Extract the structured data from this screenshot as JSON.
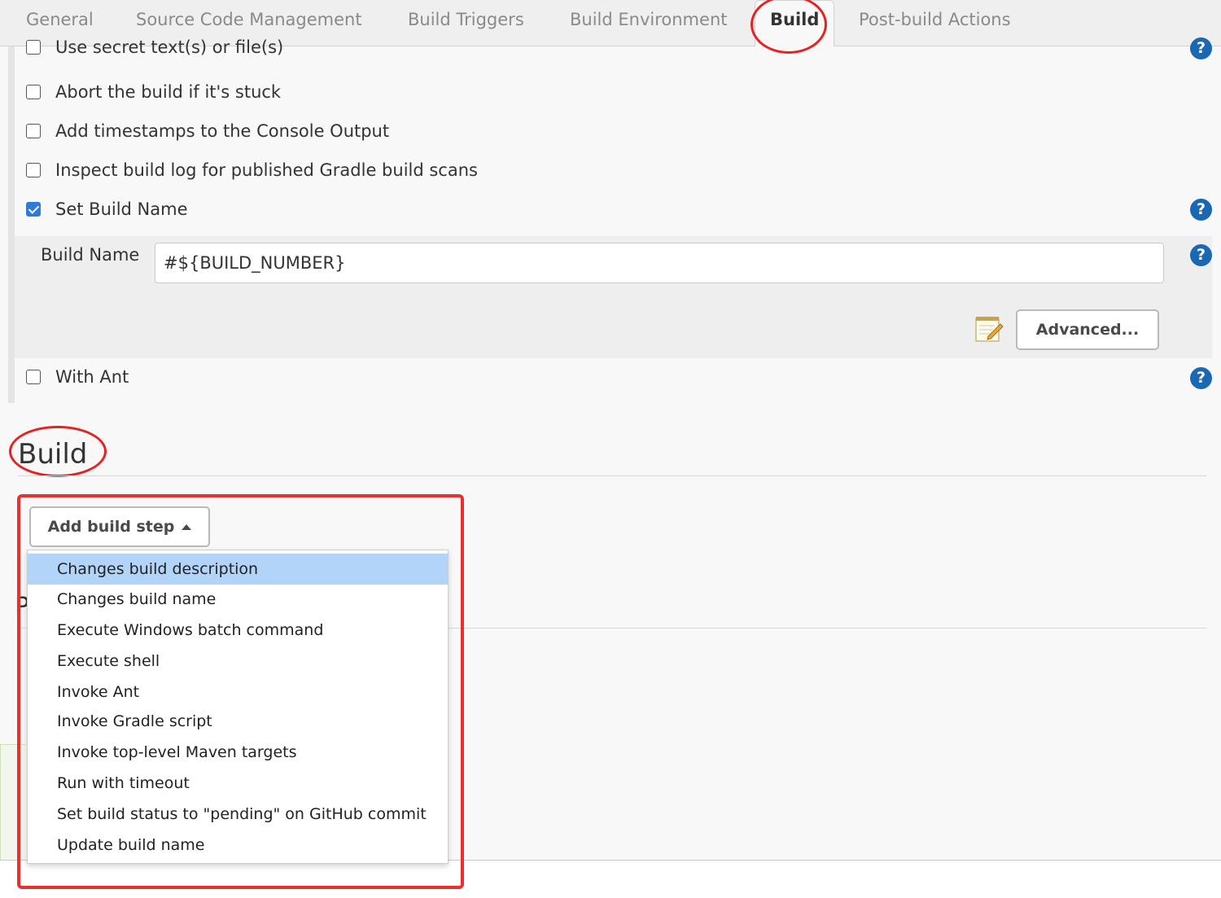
{
  "tabs": [
    {
      "label": "General"
    },
    {
      "label": "Source Code Management"
    },
    {
      "label": "Build Triggers"
    },
    {
      "label": "Build Environment"
    },
    {
      "label": "Build"
    },
    {
      "label": "Post-build Actions"
    }
  ],
  "active_tab": "Build",
  "environment_options": [
    {
      "label": "Use secret text(s) or file(s)",
      "checked": false
    },
    {
      "label": "Abort the build if it's stuck",
      "checked": false
    },
    {
      "label": "Add timestamps to the Console Output",
      "checked": false
    },
    {
      "label": "Inspect build log for published Gradle build scans",
      "checked": false
    },
    {
      "label": "Set Build Name",
      "checked": true
    },
    {
      "label": "With Ant",
      "checked": false
    }
  ],
  "build_name_field": {
    "label": "Build Name",
    "value": "#${BUILD_NUMBER}"
  },
  "advanced_button": {
    "label": "Advanced..."
  },
  "help_glyph": "?",
  "build_section": {
    "title": "Build"
  },
  "add_build_step_button": {
    "label": "Add build step"
  },
  "build_step_menu": [
    {
      "label": "Changes build description",
      "highlighted": true
    },
    {
      "label": "Changes build name"
    },
    {
      "label": "Execute Windows batch command"
    },
    {
      "label": "Execute shell"
    },
    {
      "label": "Invoke Ant"
    },
    {
      "label": "Invoke Gradle script"
    },
    {
      "label": "Invoke top-level Maven targets"
    },
    {
      "label": "Run with timeout"
    },
    {
      "label": "Set build status to \"pending\" on GitHub commit"
    },
    {
      "label": "Update build name"
    }
  ],
  "partially_hidden_heading_letter": "P",
  "colors": {
    "accent": "#2e7bd6",
    "help": "#1a67b3",
    "annotation": "#e52222",
    "menu_highlight": "#b2d4f8"
  }
}
